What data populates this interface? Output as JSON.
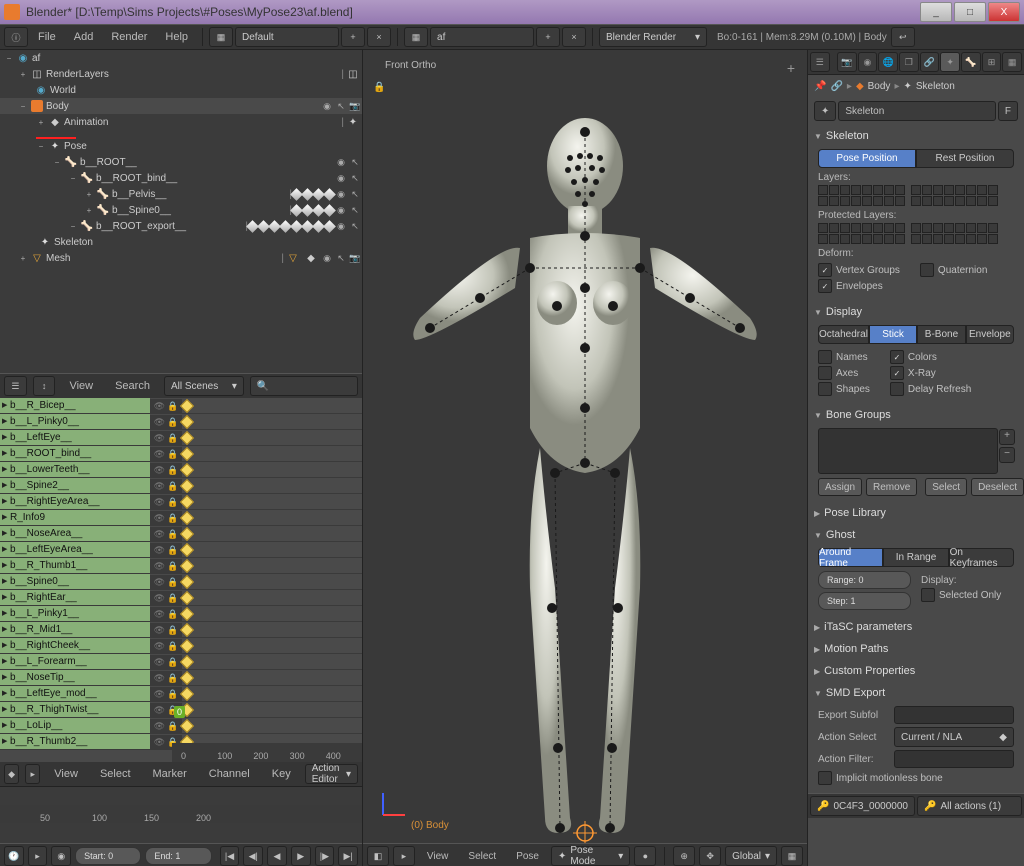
{
  "titlebar": {
    "text": "Blender* [D:\\Temp\\Sims Projects\\#Poses\\MyPose23\\af.blend]",
    "min": "_",
    "max": "□",
    "close": "X"
  },
  "topmenu": {
    "file": "File",
    "add": "Add",
    "render": "Render",
    "help": "Help",
    "layout": "Default",
    "scene": "af",
    "engine": "Blender Render",
    "stats": "Bo:0-161 | Mem:8.29M (0.10M) | Body"
  },
  "outliner": {
    "root": "af",
    "renderlayers": "RenderLayers",
    "world": "World",
    "body": "Body",
    "animation": "Animation",
    "pose": "Pose",
    "b_root": "b__ROOT__",
    "b_root_bind": "b__ROOT_bind__",
    "b_pelvis": "b__Pelvis__",
    "b_spine0": "b__Spine0__",
    "b_root_export": "b__ROOT_export__",
    "skeleton": "Skeleton",
    "mesh": "Mesh",
    "view": "View",
    "search": "Search",
    "allscenes": "All Scenes"
  },
  "actions": {
    "items": [
      "b__R_Bicep__",
      "b__L_Pinky0__",
      "b__LeftEye__",
      "b__ROOT_bind__",
      "b__LowerTeeth__",
      "b__Spine2__",
      "b__RightEyeArea__",
      "R_Info9",
      "b__NoseArea__",
      "b__LeftEyeArea__",
      "b__R_Thumb1__",
      "b__Spine0__",
      "b__RightEar__",
      "b__L_Pinky1__",
      "b__R_Mid1__",
      "b__RightCheek__",
      "b__L_Forearm__",
      "b__NoseTip__",
      "b__LeftEye_mod__",
      "b__R_ThighTwist__",
      "b__LoLip__",
      "b__R_Thumb2__"
    ],
    "ruler": [
      "0",
      "100",
      "200",
      "300",
      "400"
    ],
    "view": "View",
    "select": "Select",
    "marker": "Marker",
    "channel": "Channel",
    "key": "Key",
    "editor": "Action Editor",
    "current": "0"
  },
  "graph": {
    "ruler": [
      "50",
      "100",
      "150",
      "200"
    ],
    "start": "Start: 0",
    "end": "End: 1"
  },
  "viewport": {
    "label": "Front Ortho",
    "objname": "(0) Body",
    "view": "View",
    "select": "Select",
    "pose": "Pose",
    "mode": "Pose Mode",
    "global": "Global"
  },
  "props": {
    "body": "Body",
    "skeleton": "Skeleton",
    "skelfield": "Skeleton",
    "f": "F",
    "panel_skeleton": "Skeleton",
    "pose_position": "Pose Position",
    "rest_position": "Rest Position",
    "layers": "Layers:",
    "protected": "Protected Layers:",
    "deform": "Deform:",
    "vertex_groups": "Vertex Groups",
    "quaternion": "Quaternion",
    "envelopes": "Envelopes",
    "panel_display": "Display",
    "octahedral": "Octahedral",
    "stick": "Stick",
    "bbone": "B-Bone",
    "envelope": "Envelope",
    "names": "Names",
    "colors": "Colors",
    "axes": "Axes",
    "xray": "X-Ray",
    "shapes": "Shapes",
    "delay": "Delay Refresh",
    "panel_bonegroups": "Bone Groups",
    "assign": "Assign",
    "remove": "Remove",
    "select": "Select",
    "deselect": "Deselect",
    "panel_poselib": "Pose Library",
    "panel_ghost": "Ghost",
    "around": "Around Frame",
    "inrange": "In Range",
    "onkeys": "On Keyframes",
    "range": "Range: 0",
    "step": "Step: 1",
    "displaylbl": "Display:",
    "selonly": "Selected Only",
    "panel_itasc": "iTaSC parameters",
    "panel_motion": "Motion Paths",
    "panel_custom": "Custom Properties",
    "panel_smd": "SMD Export",
    "exportsub": "Export Subfol",
    "actionsel": "Action Select",
    "actionsel_v": "Current / NLA",
    "actionfilter": "Action Filter:",
    "implicit": "Implicit motionless bone",
    "footer1": "0C4F3_0000000",
    "footer2": "All actions (1)"
  }
}
